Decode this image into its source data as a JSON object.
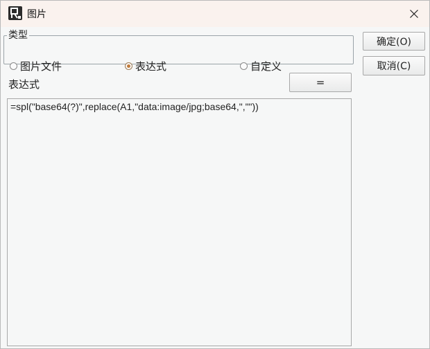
{
  "window": {
    "title": "图片",
    "app_icon": "report-app-icon",
    "close_icon": "close-icon"
  },
  "type_group": {
    "legend": "类型",
    "options": [
      {
        "label": "图片文件",
        "checked": false
      },
      {
        "label": "表达式",
        "checked": true
      },
      {
        "label": "自定义",
        "checked": false
      }
    ]
  },
  "buttons": {
    "ok": "确定(O)",
    "cancel": "取消(C)",
    "equals": "="
  },
  "expression": {
    "label": "表达式",
    "value": "=spl(\"base64(?)\",replace(A1,\"data:image/jpg;base64,\",\"\"))"
  },
  "colors": {
    "titlebar": "#faf2ee",
    "radio_checked": "#c07a3a"
  }
}
